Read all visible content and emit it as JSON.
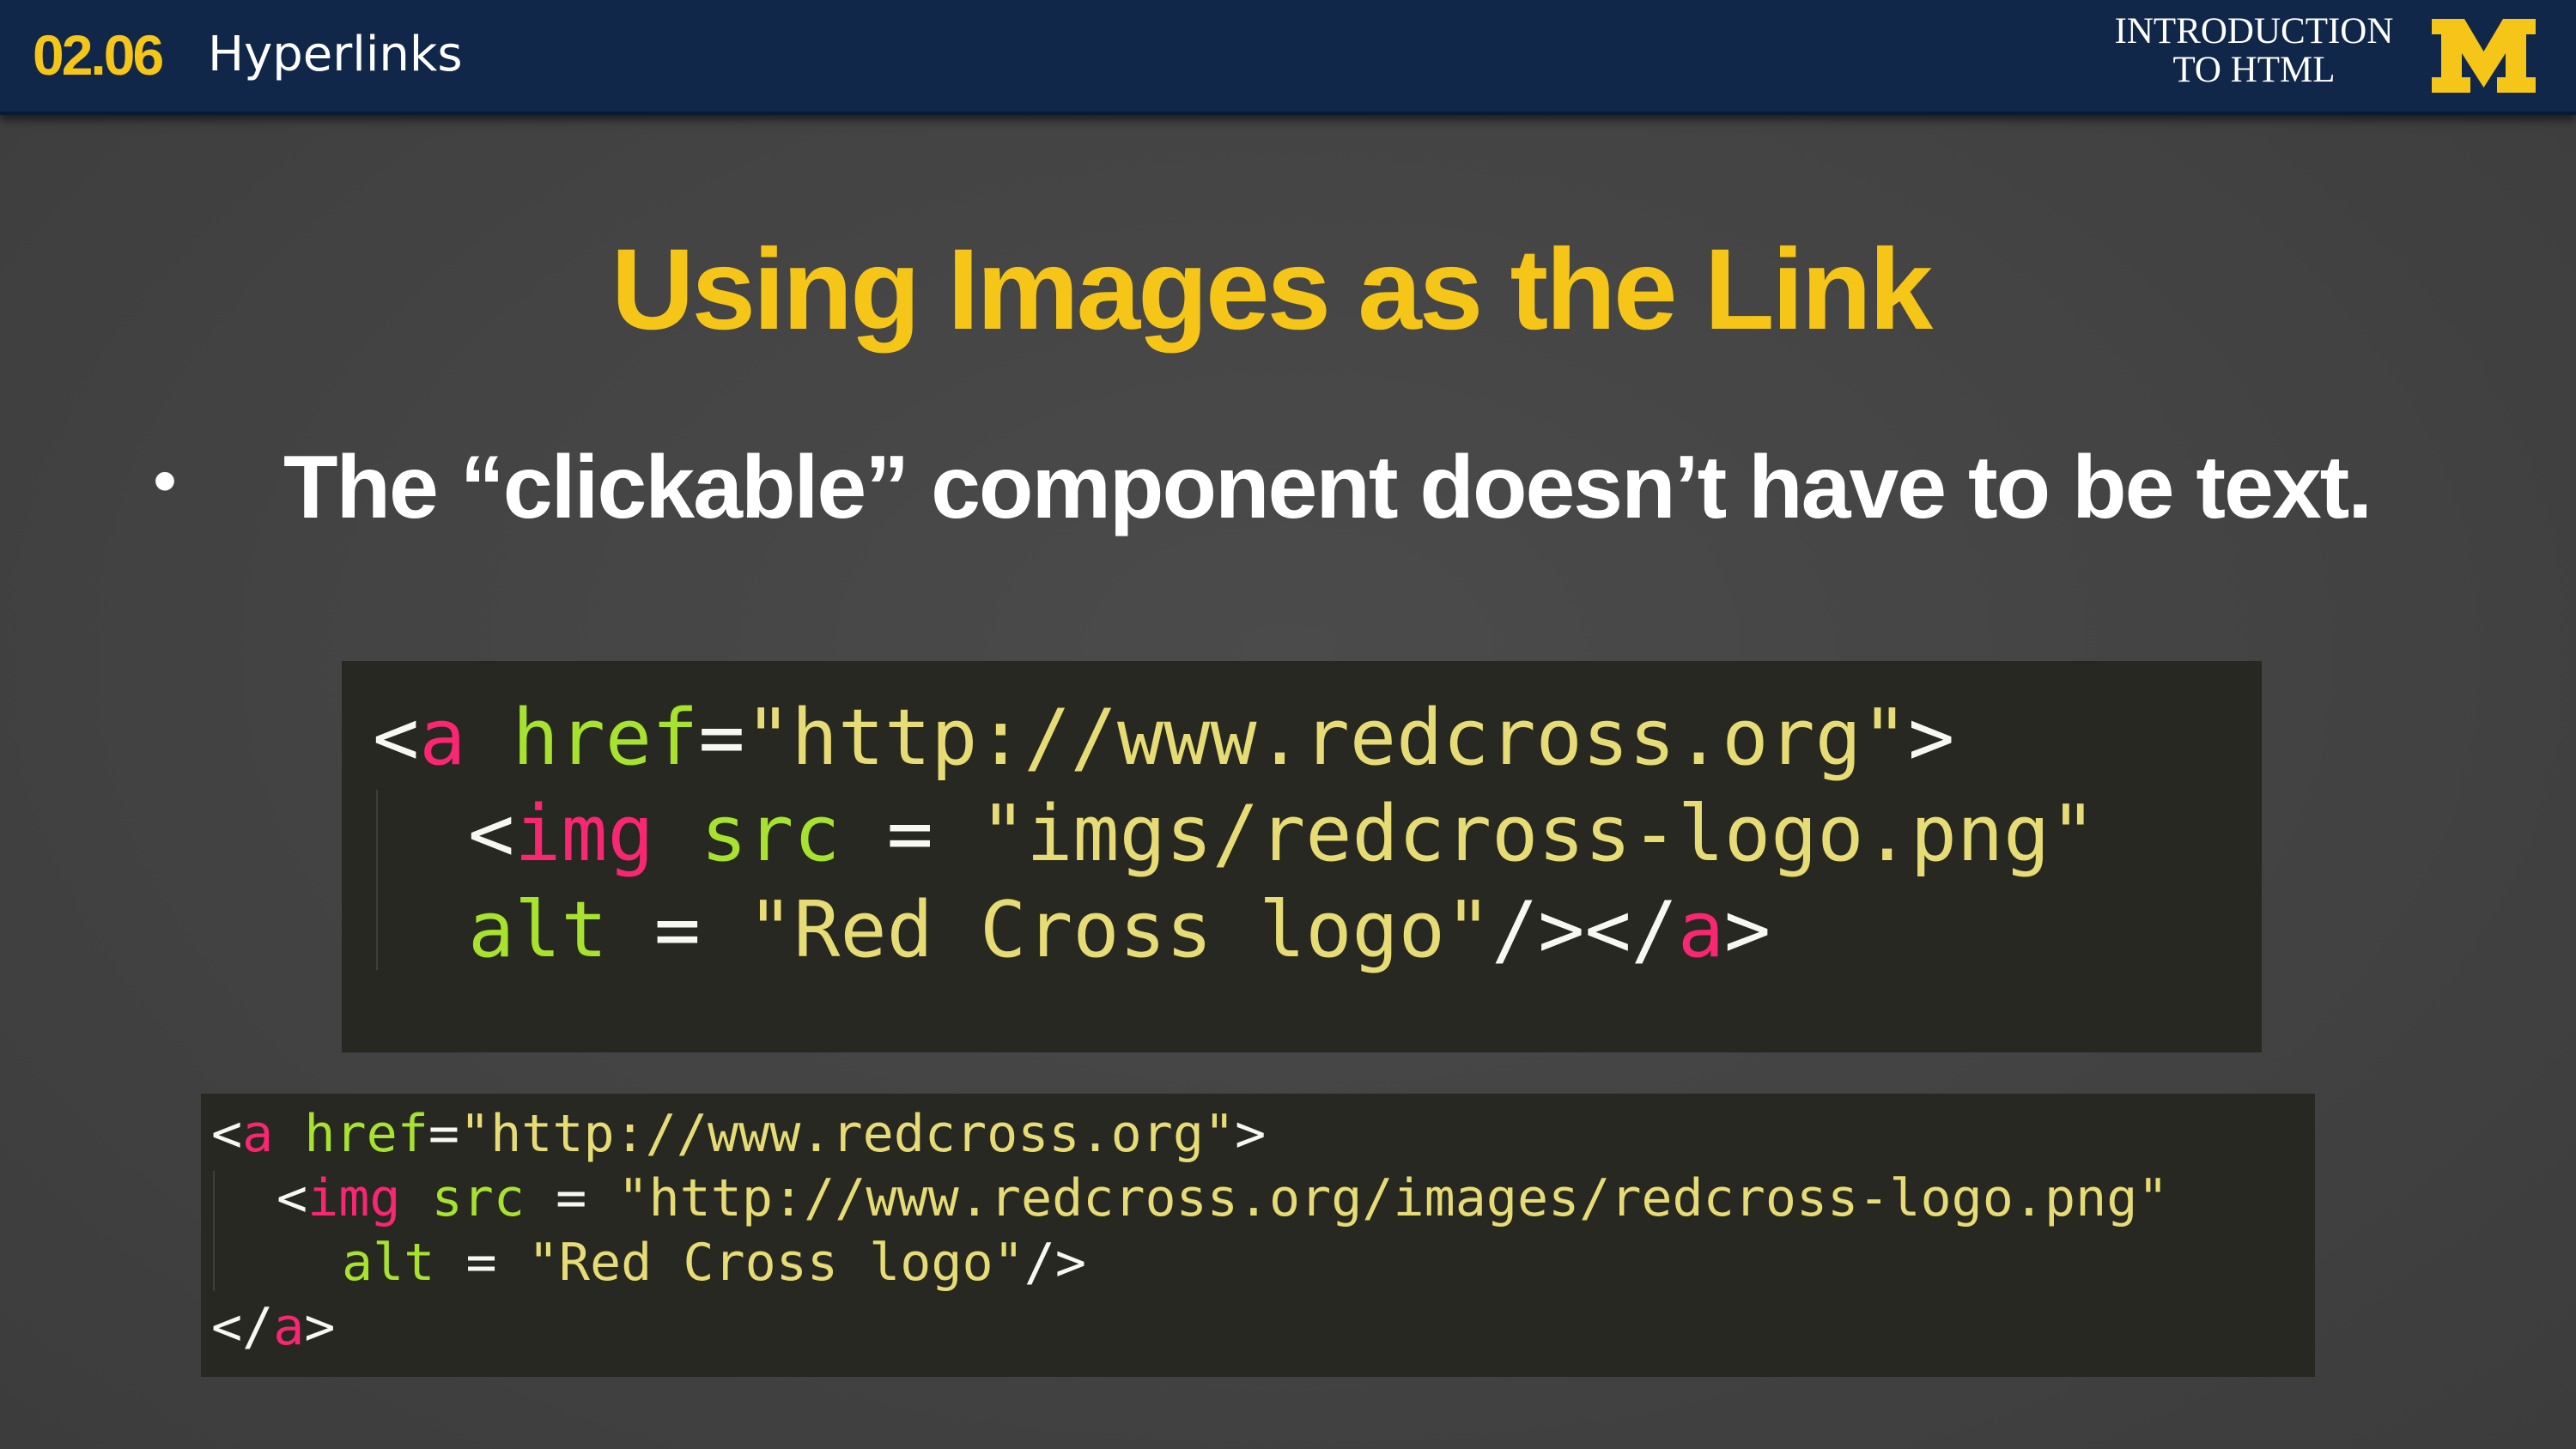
{
  "header": {
    "lesson_number": "02.06",
    "lesson_title": "Hyperlinks",
    "course_title_line1": "INTRODUCTION",
    "course_title_line2": "TO HTML",
    "logo_letter": "M",
    "logo_icon": "block-m-logo",
    "bar_color": "#10274a",
    "accent_color": "#f5c518"
  },
  "slide": {
    "title": "Using Images as the Link",
    "bullet": "The “clickable” component doesn’t have to be text."
  },
  "code_colors": {
    "background": "#272822",
    "tag": "#f92672",
    "attribute": "#a6e22e",
    "string": "#e6db74",
    "punctuation": "#f8f8f2"
  },
  "code_block_1": {
    "line1": {
      "p1": "<",
      "tag": "a",
      "sp": " ",
      "attr": "href",
      "eq": "=",
      "val": "\"http://www.redcross.org\"",
      "end": ">"
    },
    "line2": {
      "p1": "<",
      "tag": "img",
      "sp": " ",
      "attr": "src",
      "eq": " = ",
      "val": "\"imgs/redcross-logo.png\""
    },
    "line3": {
      "attr": "alt",
      "eq": " = ",
      "val": "\"Red Cross logo\"",
      "p2": "/></",
      "tag": "a",
      "end": ">"
    }
  },
  "code_block_2": {
    "line1": {
      "p1": "<",
      "tag": "a",
      "sp": " ",
      "attr": "href",
      "eq": "=",
      "val": "\"http://www.redcross.org\"",
      "end": ">"
    },
    "line2": {
      "p1": "<",
      "tag": "img",
      "sp": " ",
      "attr": "src",
      "eq": " = ",
      "val": "\"http://www.redcross.org/images/redcross-logo.png\""
    },
    "line3": {
      "attr": "alt",
      "eq": " = ",
      "val": "\"Red Cross logo\"",
      "end": "/>"
    },
    "line4": {
      "p1": "</",
      "tag": "a",
      "end": ">"
    }
  }
}
